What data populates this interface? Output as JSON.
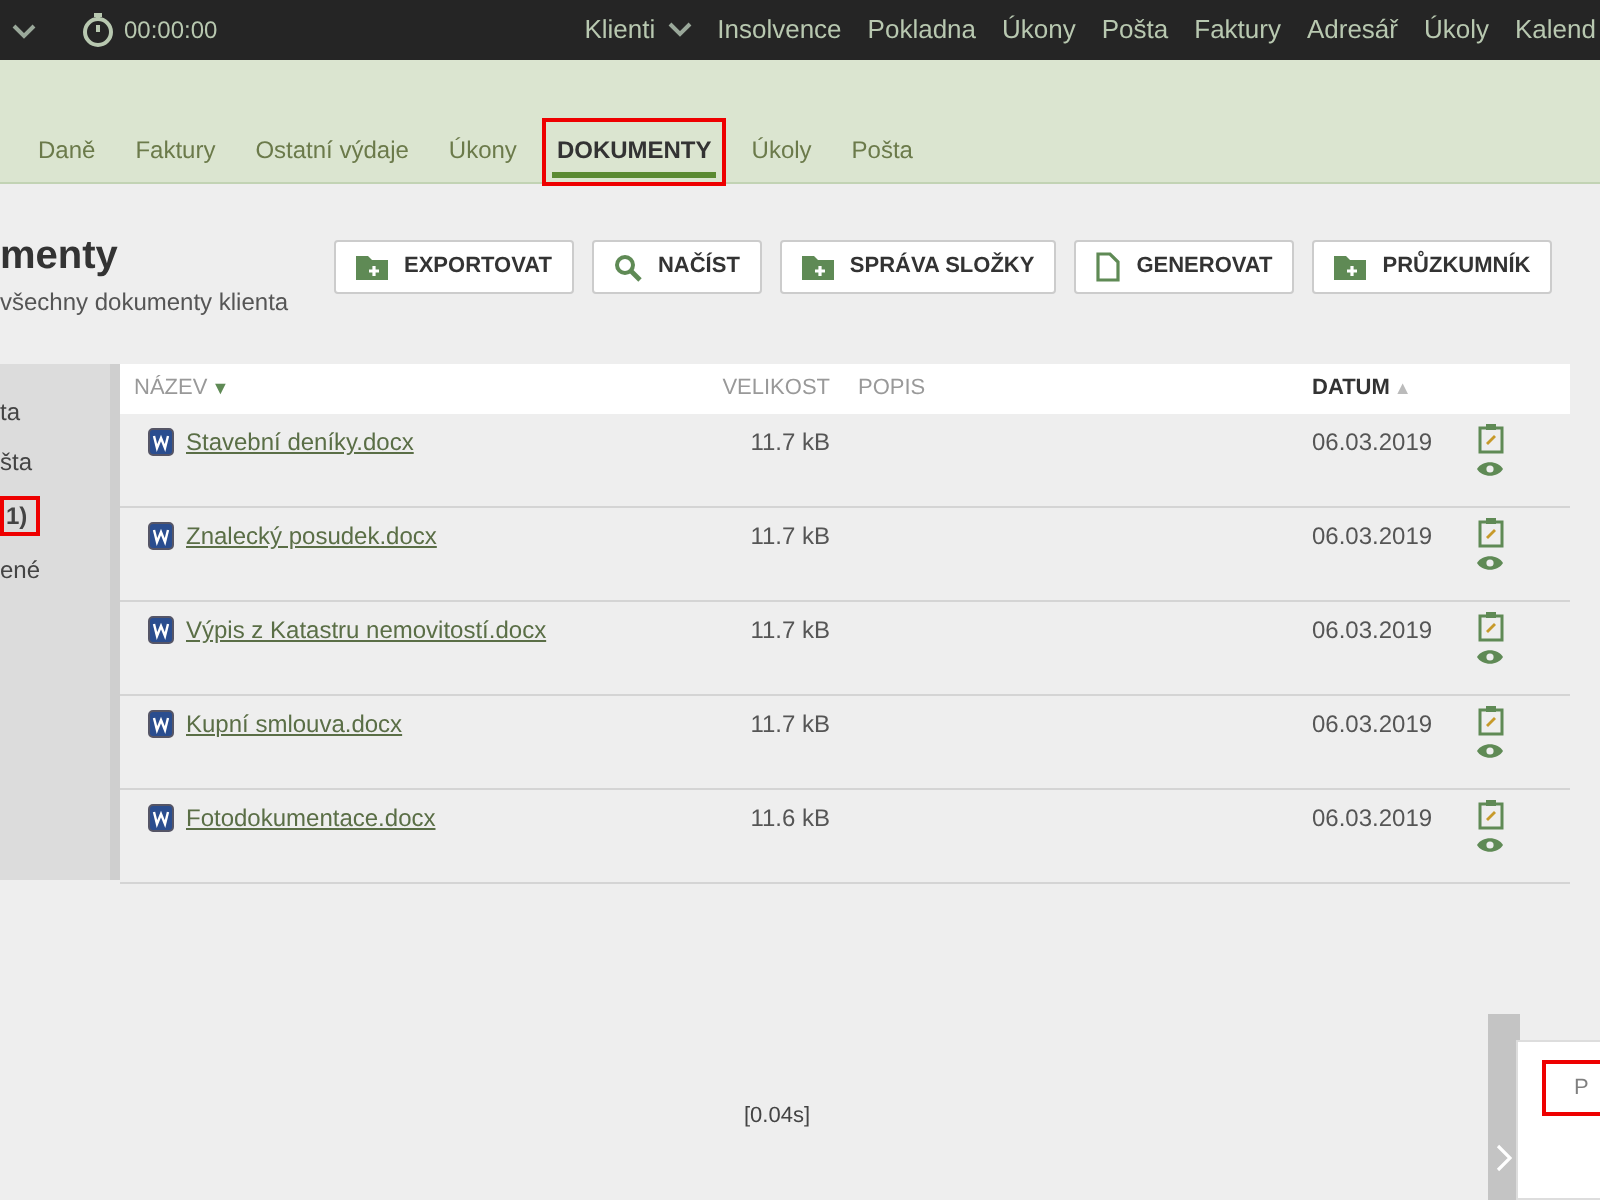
{
  "top_bar": {
    "timer": "00:00:00",
    "nav": [
      {
        "label": "Klienti",
        "dropdown": true
      },
      {
        "label": "Insolvence",
        "dropdown": false
      },
      {
        "label": "Pokladna",
        "dropdown": false
      },
      {
        "label": "Úkony",
        "dropdown": false
      },
      {
        "label": "Pošta",
        "dropdown": false
      },
      {
        "label": "Faktury",
        "dropdown": false
      },
      {
        "label": "Adresář",
        "dropdown": false
      },
      {
        "label": "Úkoly",
        "dropdown": false
      },
      {
        "label": "Kalend",
        "dropdown": false
      }
    ]
  },
  "tabs": [
    {
      "label": "Daně",
      "selected": false,
      "highlighted": false
    },
    {
      "label": "Faktury",
      "selected": false,
      "highlighted": false
    },
    {
      "label": "Ostatní výdaje",
      "selected": false,
      "highlighted": false
    },
    {
      "label": "Úkony",
      "selected": false,
      "highlighted": false
    },
    {
      "label": "DOKUMENTY",
      "selected": true,
      "highlighted": true
    },
    {
      "label": "Úkoly",
      "selected": false,
      "highlighted": false
    },
    {
      "label": "Pošta",
      "selected": false,
      "highlighted": false
    }
  ],
  "page": {
    "title": "menty",
    "subtitle": "všechny dokumenty klienta"
  },
  "buttons": [
    {
      "label": "EXPORTOVAT",
      "kind": "folder"
    },
    {
      "label": "NAČÍST",
      "kind": "search"
    },
    {
      "label": "SPRÁVA SLOŽKY",
      "kind": "folder"
    },
    {
      "label": "GENEROVAT",
      "kind": "file"
    },
    {
      "label": "PRŮZKUMNÍK",
      "kind": "folder"
    }
  ],
  "sidebar": {
    "items": [
      {
        "label": "ta",
        "highlighted": false
      },
      {
        "label": "šta",
        "highlighted": false
      },
      {
        "label": "1)",
        "highlighted": true
      },
      {
        "label": "ené",
        "highlighted": false
      }
    ]
  },
  "table": {
    "columns": [
      {
        "label": "NÁZEV",
        "sort_mark": "▼",
        "active": false
      },
      {
        "label": "VELIKOST",
        "active": false
      },
      {
        "label": "POPIS",
        "active": false
      },
      {
        "label": "DATUM",
        "sort_mark": "▲",
        "active": true
      }
    ],
    "rows": [
      {
        "name": "Stavební deníky.docx",
        "size": "11.7 kB",
        "date": "06.03.2019"
      },
      {
        "name": "Znalecký posudek.docx",
        "size": "11.7 kB",
        "date": "06.03.2019"
      },
      {
        "name": "Výpis z Katastru nemovitostí.docx",
        "size": "11.7 kB",
        "date": "06.03.2019"
      },
      {
        "name": "Kupní smlouva.docx",
        "size": "11.7 kB",
        "date": "06.03.2019"
      },
      {
        "name": "Fotodokumentace.docx",
        "size": "11.6 kB",
        "date": "06.03.2019"
      }
    ]
  },
  "footer": {
    "timing": "[0.04s]"
  },
  "side_panel": {
    "field_placeholder": "P",
    "highlighted": true
  }
}
